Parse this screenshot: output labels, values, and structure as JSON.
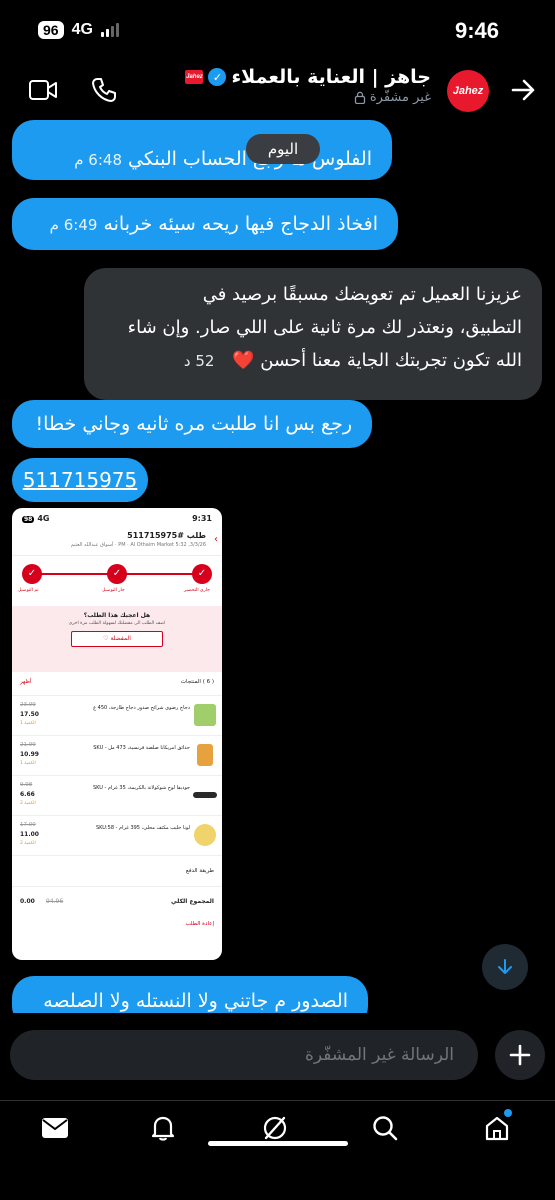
{
  "status_bar": {
    "time": "9:46",
    "battery": "96",
    "network": "4G"
  },
  "header": {
    "title": "جاهز | العناية بالعملاء",
    "subtitle": "غير مشفّرة",
    "avatar_text": "Jahez",
    "mini_logo_text": "Jahez"
  },
  "messages": {
    "date_divider": "اليوم",
    "m1": {
      "text": "الفلوس ما رجع الحساب البنكي",
      "time": "6:48 م"
    },
    "m2": {
      "text": "افخاذ الدجاج فيها ريحه سيئه خربانه",
      "time": "6:49 م"
    },
    "m3": {
      "line1": "عزيزنا العميل تم تعويضك مسبقًا برصيد في",
      "line2": "التطبيق، ونعتذر لك مرة ثانية على اللي صار. وإن شاء",
      "line3": "الله تكون تجربتك الجاية معنا أحسن ❤️",
      "time": "52 د"
    },
    "m4": {
      "text": "رجع بس انا طلبت مره ثانيه وجاني خطا!"
    },
    "m5": {
      "text": "511715975"
    },
    "m6": {
      "text": "الصدور م جاتني ولا النستله ولا الصلصه"
    }
  },
  "attachment": {
    "status_time": "9:31",
    "status_battery": "98",
    "status_network": "4G",
    "order_title": "طلب #511715975",
    "order_sub": "3/3/26, 5:32 PM · Al Othaim Market · أسواق عبدالله العثيم",
    "steps": [
      "جاري التحضير",
      "جار التوصيل",
      "تم التوصيل"
    ],
    "rate_question": "هل اعجبك هذا الطلب؟",
    "rate_hint": "اضف الطلب الى مفضلتك لسهولة الطلب مرة اخرى",
    "fav_button": "المفضلة",
    "products_label": "( 6 ) المنتجات",
    "show_label": "أظهر",
    "items": [
      {
        "name": "دجاج رضوى شرائح صدور دجاج طازجة، 450 غ",
        "old": "23.99",
        "new": "17.50",
        "qty": "1 الكمية"
      },
      {
        "name": "حدائق امريكانا صلصة فرنسية، 473 مل - SKU",
        "old": "21.99",
        "new": "10.99",
        "qty": "1 الكمية"
      },
      {
        "name": "جوديفا لوح شوكولاتة بالكريمة، 35 غرام - SKU",
        "old": "9.98",
        "new": "6.66",
        "qty": "2 الكمية"
      },
      {
        "name": "لونا حليب مكثف محلى، 395 غرام - SKU:58",
        "old": "17.00",
        "new": "11.00",
        "qty": "2 الكمية"
      }
    ],
    "payment_label": "طريقة الدفع",
    "total_label": "المجموع الكلي",
    "total_old": "94.96",
    "total_new": "0.00",
    "reorder": "إعادة الطلب"
  },
  "composer": {
    "placeholder": "الرسالة غير المشفّرة"
  },
  "colors": {
    "accent": "#1d9bf0",
    "brand": "#e8192c",
    "bubble_recv": "#2f3336"
  },
  "tabs": [
    "mail-icon",
    "bell-icon",
    "grok-icon",
    "search-icon",
    "home-icon"
  ]
}
